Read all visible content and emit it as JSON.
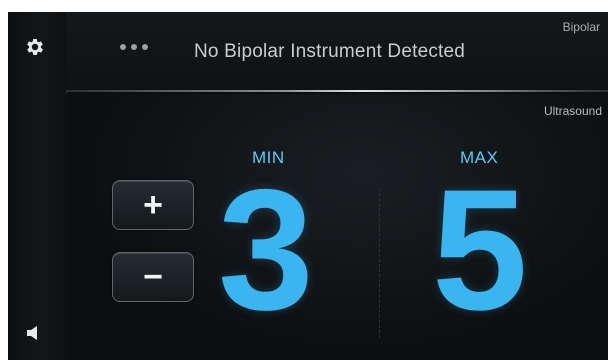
{
  "topbar": {
    "menu_icon": "more-dots-icon",
    "title": "No Bipolar Instrument Detected",
    "mode_label": "Bipolar"
  },
  "sidebar": {
    "settings_icon": "gear-icon",
    "volume_icon": "speaker-icon"
  },
  "main": {
    "mode_label": "Ultrasound",
    "min": {
      "label": "MIN",
      "value": "3"
    },
    "max": {
      "label": "MAX",
      "value": "5"
    },
    "controls": {
      "increase_label": "+",
      "decrease_label": "−"
    }
  },
  "colors": {
    "accent": "#39b6f0",
    "label_accent": "#5fc8f3",
    "background": "#0b0d0f"
  }
}
